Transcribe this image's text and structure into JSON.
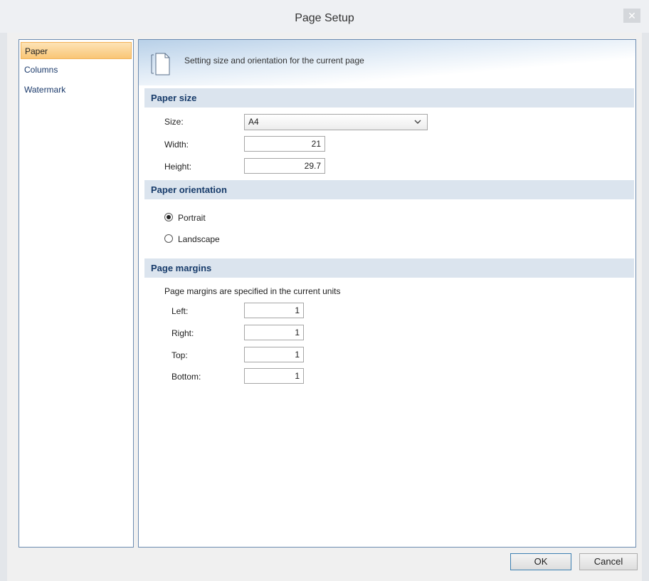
{
  "window": {
    "title": "Page Setup",
    "close_glyph": "✕"
  },
  "sidebar": {
    "items": [
      {
        "label": "Paper",
        "active": true
      },
      {
        "label": "Columns",
        "active": false
      },
      {
        "label": "Watermark",
        "active": false
      }
    ]
  },
  "banner": {
    "text": "Setting size and orientation for the current page",
    "icon": "page-icon"
  },
  "paper_size": {
    "heading": "Paper size",
    "size_label": "Size:",
    "size_value": "A4",
    "width_label": "Width:",
    "width_value": "21",
    "height_label": "Height:",
    "height_value": "29.7"
  },
  "orientation": {
    "heading": "Paper orientation",
    "portrait_label": "Portrait",
    "landscape_label": "Landscape",
    "selected": "Portrait"
  },
  "margins": {
    "heading": "Page margins",
    "note": "Page margins are specified in the current units",
    "left_label": "Left:",
    "left_value": "1",
    "right_label": "Right:",
    "right_value": "1",
    "top_label": "Top:",
    "top_value": "1",
    "bottom_label": "Bottom:",
    "bottom_value": "1"
  },
  "buttons": {
    "ok": "OK",
    "cancel": "Cancel"
  },
  "colors": {
    "active_item": "#f9c676",
    "section_header": "#dbe4ee",
    "section_text": "#173b6a",
    "frame_border": "#6c8bb0"
  }
}
